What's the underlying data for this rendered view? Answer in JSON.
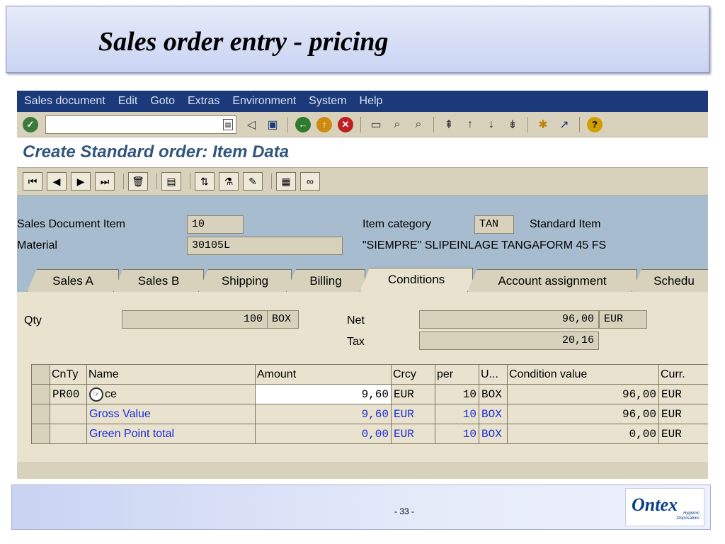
{
  "slide": {
    "title": "Sales order entry - pricing",
    "page": "- 33 -"
  },
  "menu": [
    "Sales document",
    "Edit",
    "Goto",
    "Extras",
    "Environment",
    "System",
    "Help"
  ],
  "screen_title": "Create Standard order: Item Data",
  "header": {
    "item_label": "Sales Document Item",
    "item_value": "10",
    "material_label": "Material",
    "material_value": "30105L",
    "item_category_label": "Item category",
    "item_category_value": "TAN",
    "item_category_text": "Standard Item",
    "material_desc": "\"SIEMPRE\" SLIPEINLAGE TANGAFORM 45 FS"
  },
  "tabs": [
    "Sales A",
    "Sales B",
    "Shipping",
    "Billing",
    "Conditions",
    "Account assignment",
    "Schedu"
  ],
  "active_tab": "Conditions",
  "conditions": {
    "qty_label": "Qty",
    "qty_value": "100",
    "qty_unit": "BOX",
    "net_label": "Net",
    "net_value": "96,00",
    "net_currency": "EUR",
    "tax_label": "Tax",
    "tax_value": "20,16",
    "columns": [
      "CnTy",
      "Name",
      "Amount",
      "Crcy",
      "per",
      "U...",
      "Condition value",
      "Curr."
    ],
    "rows": [
      {
        "cnty": "PR00",
        "name": "ce",
        "amount": "9,60",
        "crcy": "EUR",
        "per": "10",
        "unit": "BOX",
        "value": "96,00",
        "curr": "EUR"
      },
      {
        "cnty": "",
        "name": "Gross Value",
        "amount": "9,60",
        "crcy": "EUR",
        "per": "10",
        "unit": "BOX",
        "value": "96,00",
        "curr": "EUR"
      },
      {
        "cnty": "",
        "name": "Green Point total",
        "amount": "0,00",
        "crcy": "EUR",
        "per": "10",
        "unit": "BOX",
        "value": "0,00",
        "curr": "EUR"
      }
    ]
  },
  "logo": {
    "word": "Ontex",
    "sub1": "Hygienic",
    "sub2": "Disposables"
  },
  "colors": {
    "menubar": "#1c3a7a",
    "sap_bg": "#d8d2bd",
    "header_bg": "#a8bccf",
    "link_blue": "#1a2ed6"
  }
}
